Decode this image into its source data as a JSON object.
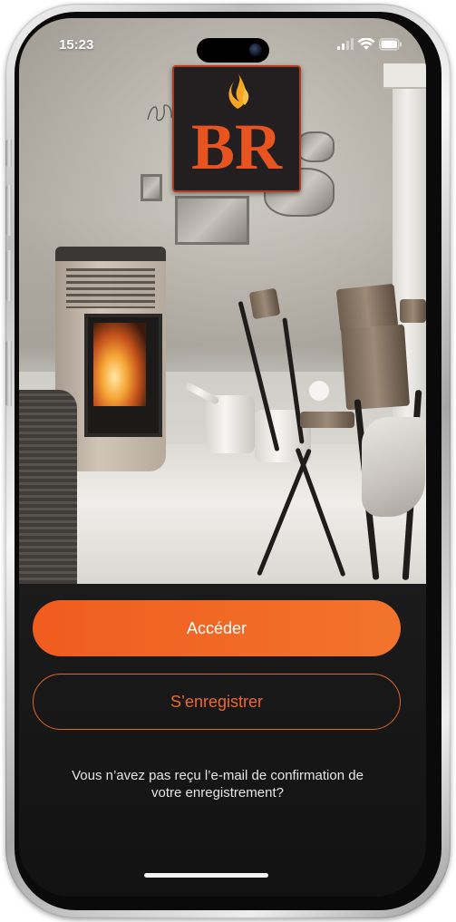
{
  "status_bar": {
    "time": "15:23",
    "icons": [
      "cellular-signal-icon",
      "wifi-icon",
      "battery-icon"
    ]
  },
  "logo": {
    "letters": "BR",
    "colors": {
      "letters": "#e8541f",
      "flame": "#f5a623",
      "background": "#231f20"
    }
  },
  "actions": {
    "primary_label": "Accéder",
    "secondary_label": "S’enregistrer"
  },
  "footer": {
    "notice": "Vous n’avez pas reçu l’e-mail de confirmation de votre enregistrement?"
  },
  "theme": {
    "accent": "#f05c1e",
    "panel_bg": "#161616",
    "text": "#e6e6e6"
  }
}
